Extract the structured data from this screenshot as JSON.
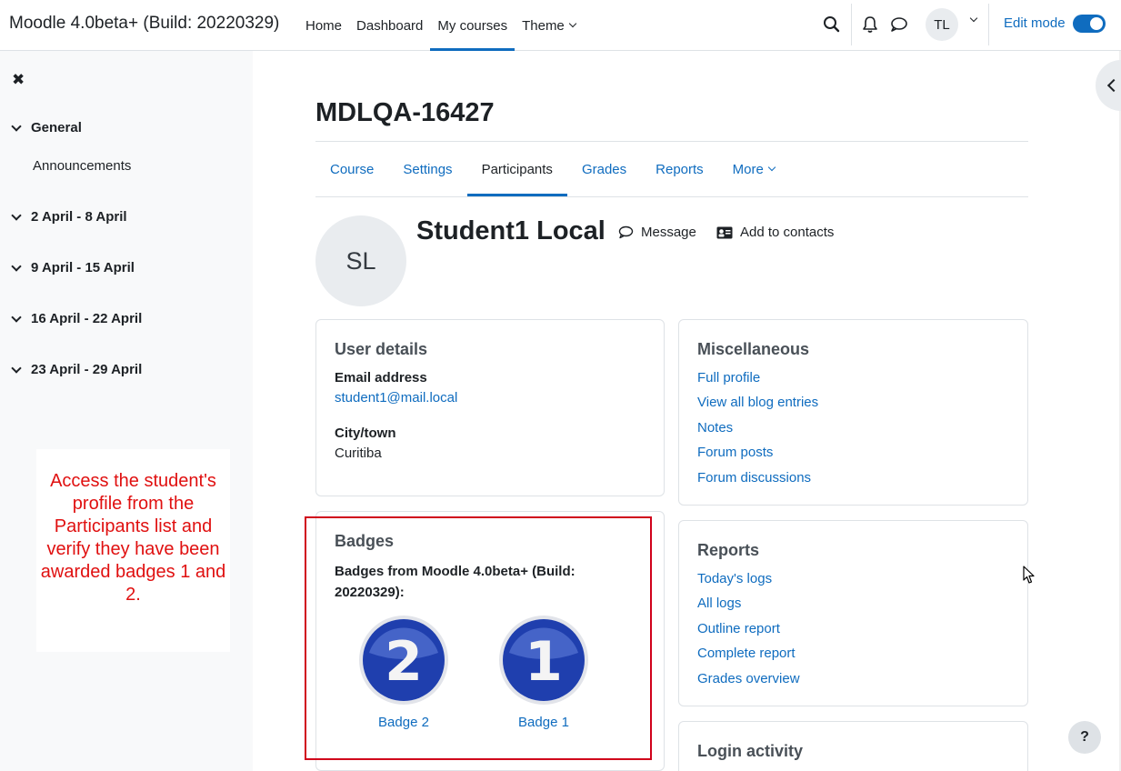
{
  "navbar": {
    "brand": "Moodle 4.0beta+ (Build: 20220329)",
    "links": [
      "Home",
      "Dashboard",
      "My courses",
      "Theme"
    ],
    "active_link": "My courses",
    "user_initials": "TL",
    "edit_mode_label": "Edit mode",
    "edit_mode_on": true
  },
  "drawer": {
    "sections": [
      {
        "label": "General",
        "activities": [
          "Announcements"
        ]
      },
      {
        "label": "2 April - 8 April"
      },
      {
        "label": "9 April - 15 April"
      },
      {
        "label": "16 April - 22 April"
      },
      {
        "label": "23 April - 29 April"
      }
    ]
  },
  "annotation": {
    "text": "Access the student's profile from the Participants list and verify they have been awarded badges 1 and 2.",
    "color": "#e01010"
  },
  "course": {
    "title": "MDLQA-16427",
    "tabs": [
      "Course",
      "Settings",
      "Participants",
      "Grades",
      "Reports",
      "More"
    ],
    "active_tab": "Participants"
  },
  "profile": {
    "initials": "SL",
    "name": "Student1 Local",
    "message_label": "Message",
    "add_contact_label": "Add to contacts"
  },
  "user_details": {
    "title": "User details",
    "email_label": "Email address",
    "email": "student1@mail.local",
    "city_label": "City/town",
    "city": "Curitiba"
  },
  "badges": {
    "title": "Badges",
    "subtitle": "Badges from Moodle 4.0beta+ (Build: 20220329):",
    "items": [
      {
        "numeral": "2",
        "label": "Badge 2"
      },
      {
        "numeral": "1",
        "label": "Badge 1"
      }
    ]
  },
  "misc": {
    "title": "Miscellaneous",
    "links": [
      "Full profile",
      "View all blog entries",
      "Notes",
      "Forum posts",
      "Forum discussions"
    ]
  },
  "reports": {
    "title": "Reports",
    "links": [
      "Today's logs",
      "All logs",
      "Outline report",
      "Complete report",
      "Grades overview"
    ]
  },
  "login_activity": {
    "title": "Login activity"
  },
  "help": {
    "label": "?"
  },
  "colors": {
    "primary": "#0f6cbf",
    "highlight_border": "#d0021b",
    "badge_blue": "#1f3fae"
  }
}
